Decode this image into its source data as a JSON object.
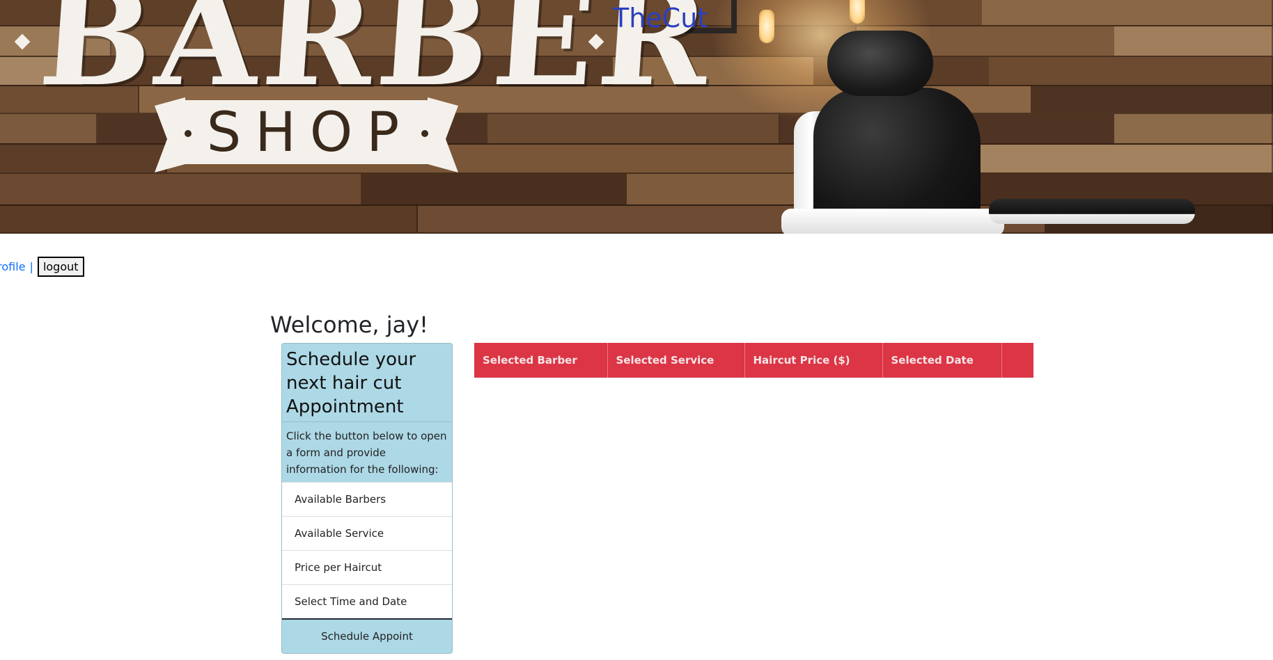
{
  "banner": {
    "logo_word": "BARBER",
    "logo_sub": "SHOP",
    "brand_title": "TheCut"
  },
  "nav": {
    "profile_label": "profile",
    "separator": "|",
    "logout_label": "logout"
  },
  "welcome": {
    "text": "Welcome, jay!"
  },
  "schedule_card": {
    "title": "Schedule your next hair cut Appointment",
    "description": "Click the button below to open a form and provide information for the following:",
    "items": [
      {
        "label": "Available Barbers"
      },
      {
        "label": "Available Service"
      },
      {
        "label": "Price per Haircut"
      },
      {
        "label": "Select Time and Date"
      }
    ],
    "button_label": "Schedule Appoint"
  },
  "appointments_table": {
    "headers": [
      "Selected Barber",
      "Selected Service",
      "Haircut Price ($)",
      "Selected Date",
      ""
    ],
    "rows": []
  },
  "colors": {
    "card_bg": "#add8e6",
    "table_header_bg": "#dc3545",
    "brand_title": "#2b3fbf",
    "link": "#0d6efd"
  }
}
